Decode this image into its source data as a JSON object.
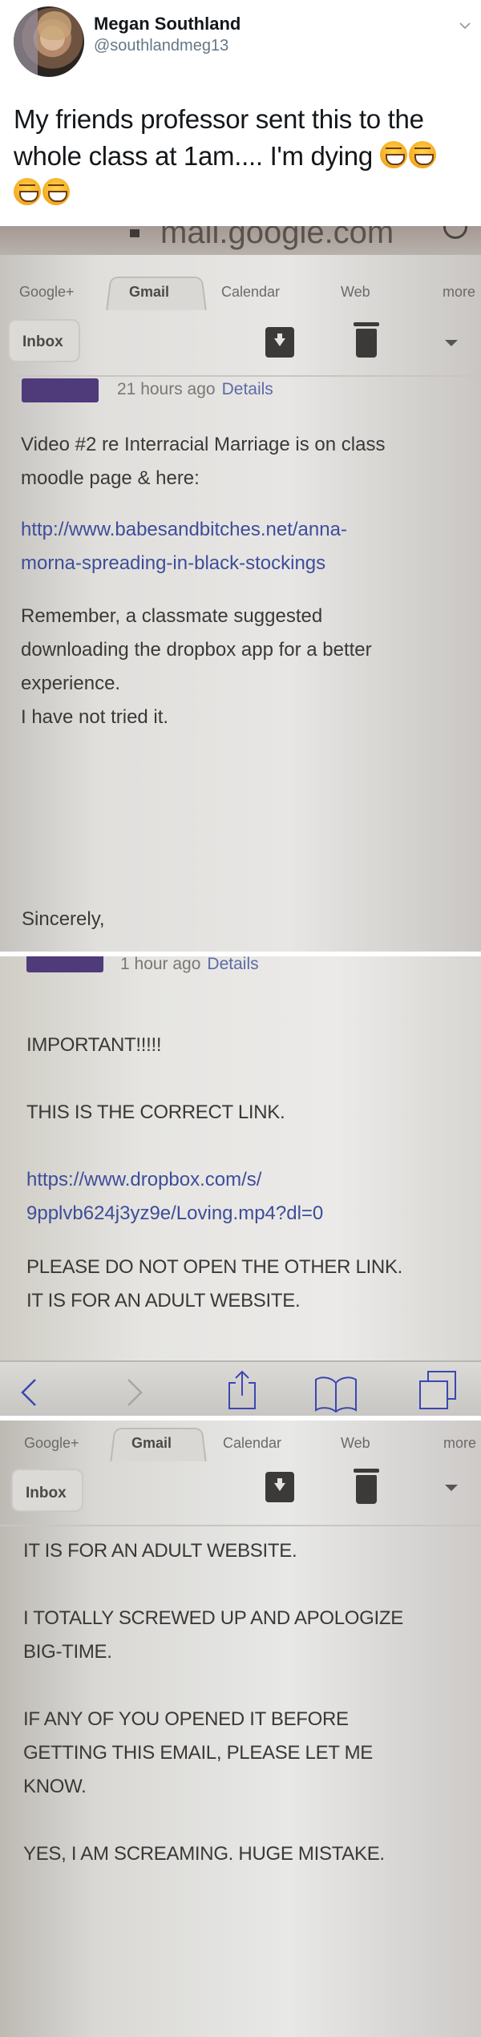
{
  "tweet": {
    "display_name": "Megan Southland",
    "handle": "@southlandmeg13",
    "text": "My friends professor sent this to the whole class at 1am.... I'm dying",
    "emoji_count": 4,
    "emoji_name": "face-with-tears-of-joy"
  },
  "screenshot1": {
    "url": "mail.google.com",
    "tabs": [
      "Google+",
      "Gmail",
      "Calendar",
      "Web",
      "more"
    ],
    "active_tab": "Gmail",
    "folder": "Inbox",
    "time": "21 hours ago",
    "details_link": "Details",
    "lines": [
      "Video #2 re Interracial Marriage is on class",
      "moodle page & here:"
    ],
    "link_lines": [
      "http://www.babesandbitches.net/anna-",
      "morna-spreading-in-black-stockings"
    ],
    "lines2": [
      "Remember, a classmate suggested",
      "downloading the dropbox app for a better",
      "experience.",
      "I have not tried it."
    ],
    "closing": "Sincerely,"
  },
  "screenshot2": {
    "time": "1 hour ago",
    "details_link": "Details",
    "important": "IMPORTANT!!!!!",
    "correct_link": "THIS IS THE CORRECT LINK.",
    "link_lines": [
      "https://www.dropbox.com/s/",
      "9pplvb624j3yz9e/Loving.mp4?dl=0"
    ],
    "warning_lines": [
      "PLEASE DO NOT OPEN THE OTHER LINK.",
      "IT IS FOR AN ADULT WEBSITE."
    ]
  },
  "screenshot3": {
    "tabs": [
      "Google+",
      "Gmail",
      "Calendar",
      "Web",
      "more"
    ],
    "active_tab": "Gmail",
    "folder": "Inbox",
    "line1": "IT IS FOR AN ADULT WEBSITE.",
    "apology": [
      "I TOTALLY SCREWED UP AND APOLOGIZE",
      "BIG-TIME."
    ],
    "request": [
      "IF ANY OF YOU OPENED IT BEFORE",
      "GETTING THIS EMAIL, PLEASE LET ME",
      "KNOW."
    ],
    "closing": "YES, I AM SCREAMING. HUGE MISTAKE."
  },
  "colors": {
    "link": "#3e4d9a",
    "sender_block": "#4f3a7a",
    "safari_icons": "#3b47b0"
  }
}
